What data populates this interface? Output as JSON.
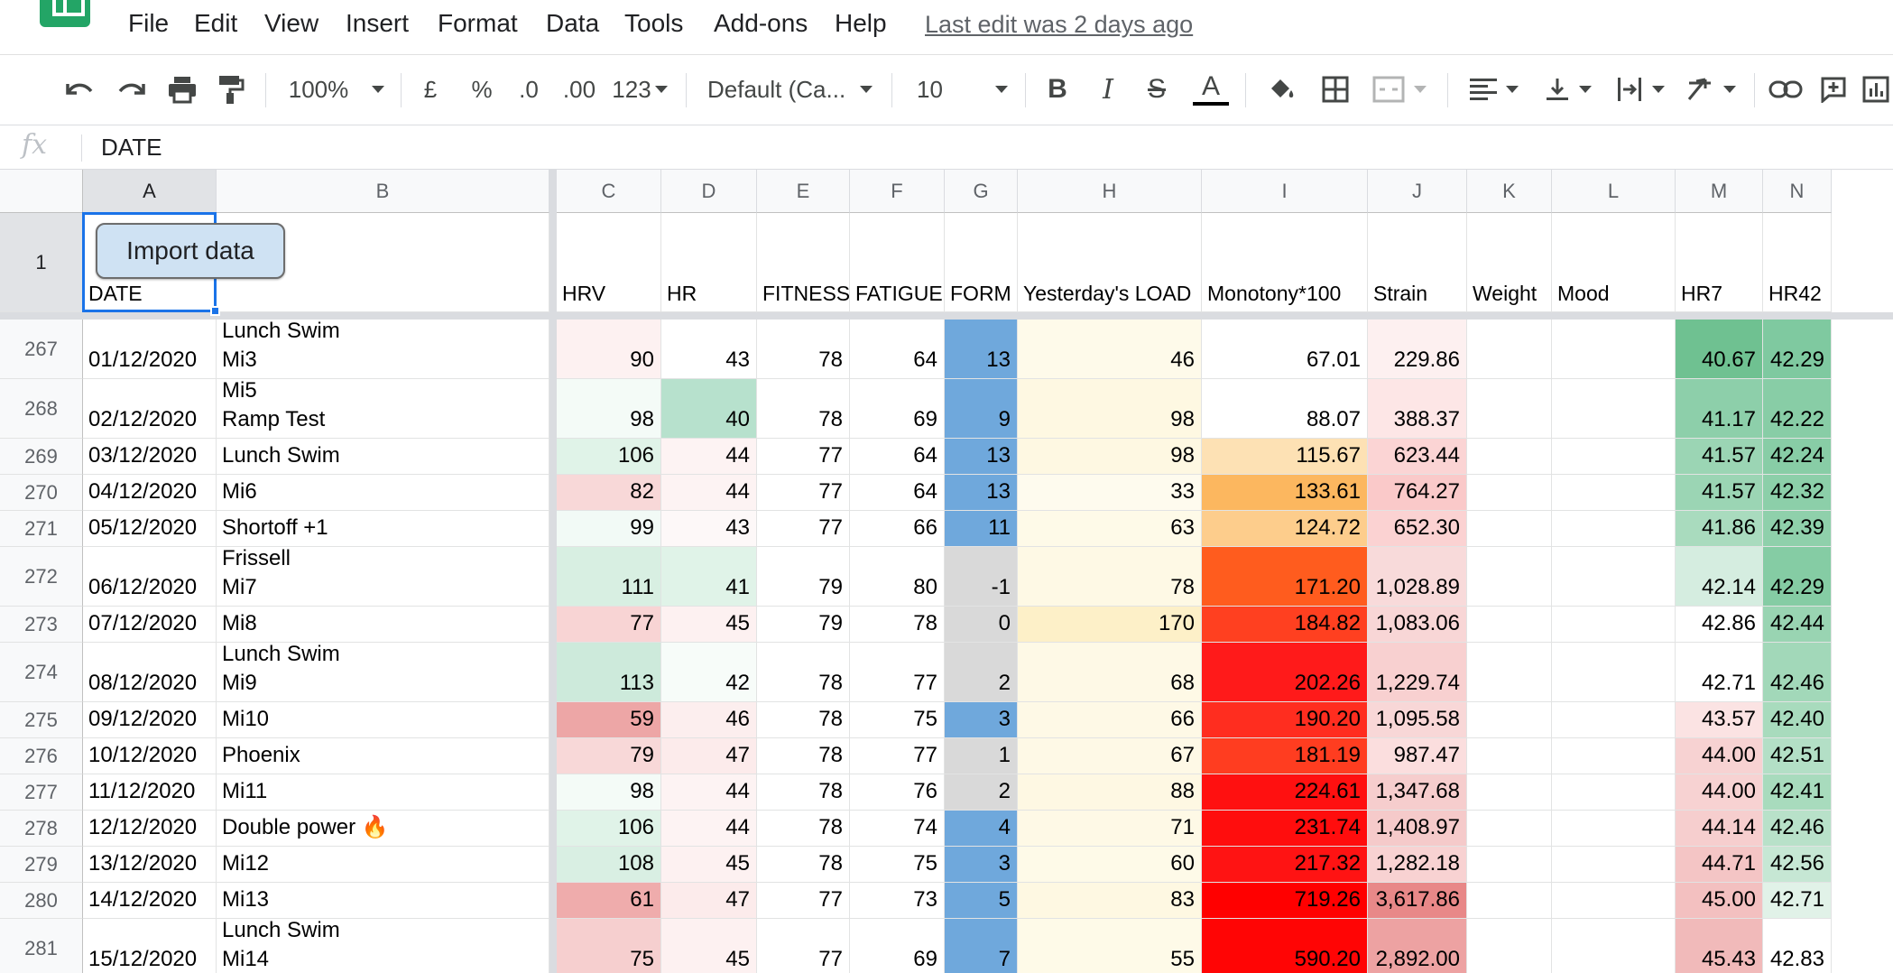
{
  "menu": [
    "File",
    "Edit",
    "View",
    "Insert",
    "Format",
    "Data",
    "Tools",
    "Add-ons",
    "Help"
  ],
  "last_edit": "Last edit was 2 days ago",
  "toolbar": {
    "zoom": "100%",
    "currency": "£",
    "percent": "%",
    "decimal_decrease": ".0",
    "decimal_increase": ".00",
    "more_formats": "123",
    "font": "Default (Ca...",
    "font_size": "10",
    "bold": "B",
    "italic": "I",
    "strikethrough": "S",
    "text_color": "A"
  },
  "formula_bar": {
    "fx": "fx",
    "value": "DATE"
  },
  "columns": [
    "A",
    "B",
    "C",
    "D",
    "E",
    "F",
    "G",
    "H",
    "I",
    "J",
    "K",
    "L",
    "M",
    "N"
  ],
  "import_button": "Import data",
  "header_row": {
    "number": "1",
    "labels": [
      "DATE",
      "",
      "HRV",
      "HR",
      "FITNESS",
      "FATIGUE",
      "FORM",
      "Yesterday's LOAD",
      "Monotony*100",
      "Strain",
      "Weight",
      "Mood",
      "HR7",
      "HR42"
    ]
  },
  "rows": [
    {
      "n": "267",
      "c": [
        "01/12/2020",
        "Lunch Swim\nMi3",
        "90",
        "43",
        "78",
        "64",
        "13",
        "46",
        "67.01",
        "229.86",
        "",
        "",
        "40.67",
        "42.29"
      ]
    },
    {
      "n": "268",
      "c": [
        "02/12/2020",
        "Mi5\nRamp Test",
        "98",
        "40",
        "78",
        "69",
        "9",
        "98",
        "88.07",
        "388.37",
        "",
        "",
        "41.17",
        "42.22"
      ]
    },
    {
      "n": "269",
      "c": [
        "03/12/2020",
        "Lunch Swim",
        "106",
        "44",
        "77",
        "64",
        "13",
        "98",
        "115.67",
        "623.44",
        "",
        "",
        "41.57",
        "42.24"
      ]
    },
    {
      "n": "270",
      "c": [
        "04/12/2020",
        "Mi6",
        "82",
        "44",
        "77",
        "64",
        "13",
        "33",
        "133.61",
        "764.27",
        "",
        "",
        "41.57",
        "42.32"
      ]
    },
    {
      "n": "271",
      "c": [
        "05/12/2020",
        "Shortoff +1",
        "99",
        "43",
        "77",
        "66",
        "11",
        "63",
        "124.72",
        "652.30",
        "",
        "",
        "41.86",
        "42.39"
      ]
    },
    {
      "n": "272",
      "c": [
        "06/12/2020",
        "Frissell\nMi7",
        "111",
        "41",
        "79",
        "80",
        "-1",
        "78",
        "171.20",
        "1,028.89",
        "",
        "",
        "42.14",
        "42.29"
      ]
    },
    {
      "n": "273",
      "c": [
        "07/12/2020",
        "Mi8",
        "77",
        "45",
        "79",
        "78",
        "0",
        "170",
        "184.82",
        "1,083.06",
        "",
        "",
        "42.86",
        "42.44"
      ]
    },
    {
      "n": "274",
      "c": [
        "08/12/2020",
        "Lunch Swim\nMi9",
        "113",
        "42",
        "78",
        "77",
        "2",
        "68",
        "202.26",
        "1,229.74",
        "",
        "",
        "42.71",
        "42.46"
      ]
    },
    {
      "n": "275",
      "c": [
        "09/12/2020",
        "Mi10",
        "59",
        "46",
        "78",
        "75",
        "3",
        "66",
        "190.20",
        "1,095.58",
        "",
        "",
        "43.57",
        "42.40"
      ]
    },
    {
      "n": "276",
      "c": [
        "10/12/2020",
        "Phoenix",
        "79",
        "47",
        "78",
        "77",
        "1",
        "67",
        "181.19",
        "987.47",
        "",
        "",
        "44.00",
        "42.51"
      ]
    },
    {
      "n": "277",
      "c": [
        "11/12/2020",
        "Mi11",
        "98",
        "44",
        "78",
        "76",
        "2",
        "88",
        "224.61",
        "1,347.68",
        "",
        "",
        "44.00",
        "42.41"
      ]
    },
    {
      "n": "278",
      "c": [
        "12/12/2020",
        "Double power 🔥",
        "106",
        "44",
        "78",
        "74",
        "4",
        "71",
        "231.74",
        "1,408.97",
        "",
        "",
        "44.14",
        "42.46"
      ]
    },
    {
      "n": "279",
      "c": [
        "13/12/2020",
        "Mi12",
        "108",
        "45",
        "78",
        "75",
        "3",
        "60",
        "217.32",
        "1,282.18",
        "",
        "",
        "44.71",
        "42.56"
      ]
    },
    {
      "n": "280",
      "c": [
        "14/12/2020",
        "Mi13",
        "61",
        "47",
        "77",
        "73",
        "5",
        "83",
        "719.26",
        "3,617.86",
        "",
        "",
        "45.00",
        "42.71"
      ]
    },
    {
      "n": "281",
      "c": [
        "15/12/2020",
        "Lunch Swim\nMi14",
        "75",
        "45",
        "77",
        "69",
        "7",
        "55",
        "590.20",
        "2,892.00",
        "",
        "",
        "45.43",
        "42.83"
      ]
    }
  ],
  "cell_colors": [
    [
      "",
      "",
      "#fdf1f1",
      "",
      "",
      "",
      "#6fa8dc",
      "#fefaea",
      "",
      "#fdf0f0",
      "",
      "",
      "#6fc191",
      "#7fc9a0"
    ],
    [
      "",
      "",
      "#f4fbf7",
      "#b7e1cd",
      "",
      "",
      "#6fa8dc",
      "#fef8e2",
      "",
      "#fde6e6",
      "",
      "",
      "#8dcfaa",
      "#88cda6"
    ],
    [
      "",
      "",
      "#e0f3e8",
      "#fdf3f3",
      "",
      "",
      "#6fa8dc",
      "#fef8e2",
      "#fde1b4",
      "#fbd4d4",
      "",
      "",
      "#9bd5b4",
      "#88cda6"
    ],
    [
      "",
      "",
      "#f8d8d8",
      "#fdf3f3",
      "",
      "",
      "#6fa8dc",
      "#fefbee",
      "#fcb75f",
      "#fac9c9",
      "",
      "",
      "#9bd5b4",
      "#8ccfa9"
    ],
    [
      "",
      "",
      "#f2faf6",
      "#fdf8f8",
      "",
      "",
      "#6fa8dc",
      "#fefae8",
      "#fdcd8c",
      "#fbd2d2",
      "",
      "",
      "#a9dbbe",
      "#8fd0ab"
    ],
    [
      "",
      "",
      "#d8efe2",
      "#e0f3e8",
      "",
      "",
      "#d9d9d9",
      "#fef9e5",
      "#ff5c1e",
      "#f8dada",
      "",
      "",
      "#d5ede0",
      "#85cca4"
    ],
    [
      "",
      "",
      "#f8d4d4",
      "#fdf1f1",
      "",
      "",
      "#d9d9d9",
      "#fdf0c8",
      "#ff4020",
      "#f8d6d6",
      "",
      "",
      "",
      "#99d4b2"
    ],
    [
      "",
      "",
      "#cdeadb",
      "#f7fcf9",
      "",
      "",
      "#d9d9d9",
      "#fef9e6",
      "#ff1a1a",
      "#f8d0d0",
      "",
      "",
      "",
      "#a2d8b9"
    ],
    [
      "",
      "",
      "#eda6a6",
      "#fceeee",
      "",
      "",
      "#6fa8dc",
      "#fef9e6",
      "#ff2d1f",
      "#f8d7d7",
      "",
      "",
      "#fbe3e3",
      "#a8dbbd"
    ],
    [
      "",
      "",
      "#f8d8d8",
      "#fcebeb",
      "",
      "",
      "#d9d9d9",
      "#fef9e6",
      "#ff3d20",
      "#fbdede",
      "",
      "",
      "#f7d2d2",
      "#b3dfc6"
    ],
    [
      "",
      "",
      "#f4fbf7",
      "#fdf3f3",
      "",
      "",
      "#d9d9d9",
      "#fef8e3",
      "#ff1010",
      "#f6cdcd",
      "",
      "",
      "#f7d2d2",
      "#a8dbbd"
    ],
    [
      "",
      "",
      "#e0f3e8",
      "#fdf3f3",
      "",
      "",
      "#6fa8dc",
      "#fef9e6",
      "#ff0d0d",
      "#f5caca",
      "",
      "",
      "#f6cece",
      "#b8e1c9"
    ],
    [
      "",
      "",
      "#d9efe3",
      "#fdf1f1",
      "",
      "",
      "#6fa8dc",
      "#fefae8",
      "#ff1313",
      "#f8d2d2",
      "",
      "",
      "#f4c5c5",
      "#c6e7d4"
    ],
    [
      "",
      "",
      "#efacac",
      "#fcebeb",
      "",
      "",
      "#6fa8dc",
      "#fef8e2",
      "#ff0000",
      "#e88888",
      "",
      "",
      "#f3c0c0",
      "#e1f2e8"
    ],
    [
      "",
      "",
      "#f6cfcf",
      "#fdf1f1",
      "",
      "",
      "#6fa8dc",
      "#fefae8",
      "#ff0505",
      "#eda2a2",
      "",
      "",
      "#f1baba",
      "#ffffff"
    ]
  ],
  "icons": {
    "undo": "undo-icon",
    "redo": "redo-icon",
    "print": "print-icon",
    "paint_format": "paint-format-icon",
    "fill_color": "fill-color-icon",
    "borders": "borders-icon",
    "merge": "merge-icon",
    "align": "align-left-icon",
    "valign": "align-bottom-icon",
    "wrap": "text-wrap-icon",
    "rotate": "text-rotate-icon",
    "link": "link-icon",
    "comment": "comment-icon",
    "chart": "chart-icon"
  }
}
